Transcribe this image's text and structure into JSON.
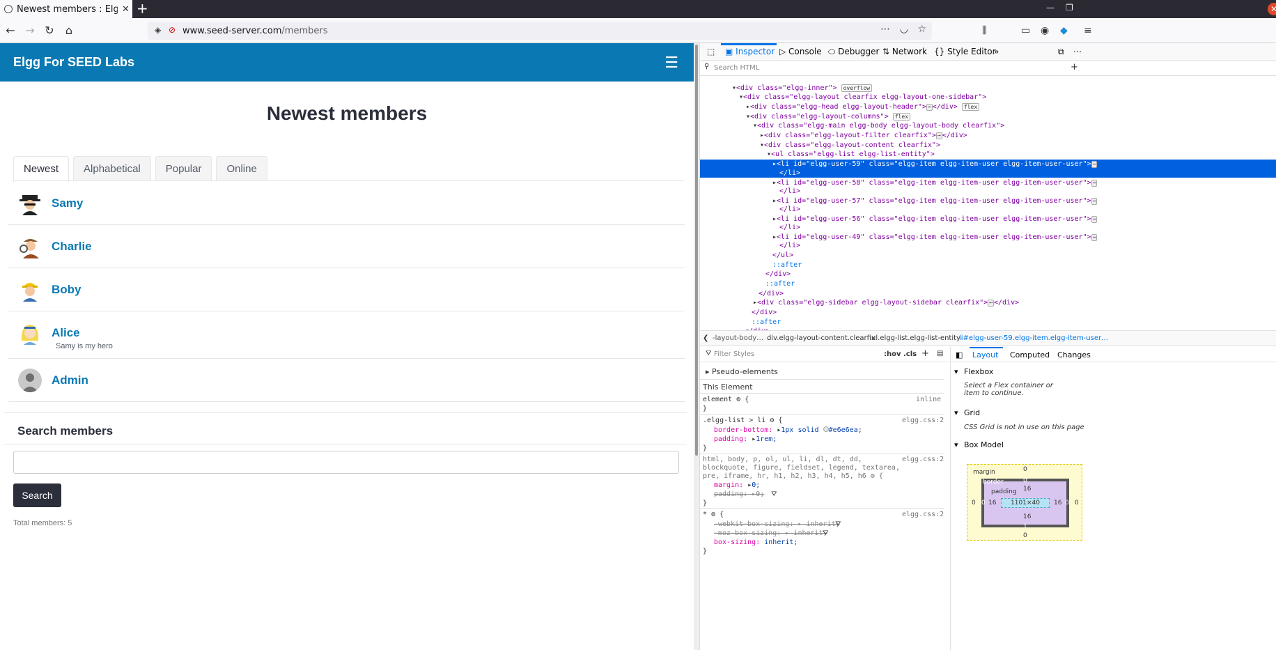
{
  "browser": {
    "tab_title": "Newest members : Elgg f",
    "url_host": "www.seed-server.com",
    "url_path": "/members"
  },
  "site": {
    "name": "Elgg For SEED Labs",
    "page_title": "Newest members",
    "tabs": [
      {
        "label": "Newest",
        "active": true
      },
      {
        "label": "Alphabetical",
        "active": false
      },
      {
        "label": "Popular",
        "active": false
      },
      {
        "label": "Online",
        "active": false
      }
    ],
    "members": [
      {
        "name": "Samy",
        "brief": "",
        "icon": "spy-avatar"
      },
      {
        "name": "Charlie",
        "brief": "",
        "icon": "detective-avatar"
      },
      {
        "name": "Boby",
        "brief": "",
        "icon": "builder-avatar"
      },
      {
        "name": "Alice",
        "brief": "Samy is my hero",
        "icon": "alice-avatar"
      },
      {
        "name": "Admin",
        "brief": "",
        "icon": "default-avatar"
      }
    ],
    "search_heading": "Search members",
    "search_button": "Search",
    "total": "Total members: 5"
  },
  "devtools": {
    "tabs": [
      "Inspector",
      "Console",
      "Debugger",
      "Network",
      "Style Editor"
    ],
    "search_placeholder": "Search HTML",
    "tree": [
      {
        "pre": "<div class=\"elgg-inner\">",
        "badge": "overflow"
      },
      {
        "pre": "<div class=\"elgg-layout clearfix elgg-layout-one-sidebar\">"
      },
      {
        "pre": "<div class=\"elgg-head elgg-layout-header\">",
        "post": "</div>",
        "badge": "flex"
      },
      {
        "pre": "<div class=\"elgg-layout-columns\">",
        "badge": "flex"
      },
      {
        "pre": "<div class=\"elgg-main elgg-body elgg-layout-body clearfix\">"
      },
      {
        "pre": "<div class=\"elgg-layout-filter clearfix\">",
        "post": "</div>"
      },
      {
        "pre": "<div class=\"elgg-layout-content clearfix\">"
      },
      {
        "pre": "<ul class=\"elgg-list elgg-list-entity\">"
      },
      {
        "pre": "<li id=\"elgg-user-59\" class=\"elgg-item elgg-item-user elgg-item-user-user\">"
      },
      {
        "pre": "</li>"
      },
      {
        "pre": "<li id=\"elgg-user-58\" class=\"elgg-item elgg-item-user elgg-item-user-user\">"
      },
      {
        "pre": "</li>"
      },
      {
        "pre": "<li id=\"elgg-user-57\" class=\"elgg-item elgg-item-user elgg-item-user-user\">"
      },
      {
        "pre": "</li>"
      },
      {
        "pre": "<li id=\"elgg-user-56\" class=\"elgg-item elgg-item-user elgg-item-user-user\">"
      },
      {
        "pre": "</li>"
      },
      {
        "pre": "<li id=\"elgg-user-49\" class=\"elgg-item elgg-item-user elgg-item-user-user\">"
      },
      {
        "pre": "</li>"
      },
      {
        "pre": "</ul>"
      },
      {
        "pre": "::after"
      },
      {
        "pre": "</div>"
      },
      {
        "pre": "::after"
      },
      {
        "pre": "</div>"
      },
      {
        "pre": "<div class=\"elgg-sidebar elgg-layout-sidebar clearfix\">",
        "post": "</div>"
      },
      {
        "pre": "</div>"
      },
      {
        "pre": "::after"
      },
      {
        "pre": "</div>"
      }
    ],
    "breadcrumbs": [
      "-layout-body…",
      "div.elgg-layout-content.clearfix",
      "ul.elgg-list.elgg-list-entity",
      "li#elgg-user-59.elgg-item.elgg-item-user…"
    ],
    "filter_placeholder": "Filter Styles",
    "hov": ":hov",
    "cls": ".cls",
    "pseudo": "Pseudo-elements",
    "this_element": "This Element",
    "rules": {
      "element": "element",
      "inline": "inline",
      "sel1": ".elgg-list > li",
      "src": "elgg.css:2",
      "border_bottom_prop": "border-bottom:",
      "border_bottom_val": "1px solid",
      "color_hex": "#e6e6ea",
      "padding_prop": "padding:",
      "padding_val": "1rem;",
      "sel2a": "html, body, p, ol, ul, li, dl, dt, dd,",
      "sel2b": "blockquote, figure, fieldset, legend, textarea,",
      "sel2c": "pre, iframe, hr, h1, h2, h3, h4, h5, h6",
      "margin_prop": "margin:",
      "margin_val": "0;",
      "padding2_prop": "padding:",
      "padding2_val": "0;",
      "sel3": "*",
      "wk_prop": "-webkit-box-sizing:",
      "wk_val": "inherit;",
      "moz_prop": "-moz-box-sizing:",
      "moz_val": "inherit;",
      "bs_prop": "box-sizing:",
      "bs_val": "inherit;"
    },
    "side_tabs": [
      "Layout",
      "Computed",
      "Changes"
    ],
    "flexbox": "Flexbox",
    "flexbox_msg": "Select a Flex container or item to continue.",
    "grid": "Grid",
    "grid_msg": "CSS Grid is not in use on this page",
    "box_model": "Box Model",
    "bm": {
      "margin": "margin",
      "border": "border",
      "padding": "padding",
      "content": "1101×40",
      "m": "0",
      "b": "0",
      "p": "16",
      "b_bottom": "1"
    }
  }
}
